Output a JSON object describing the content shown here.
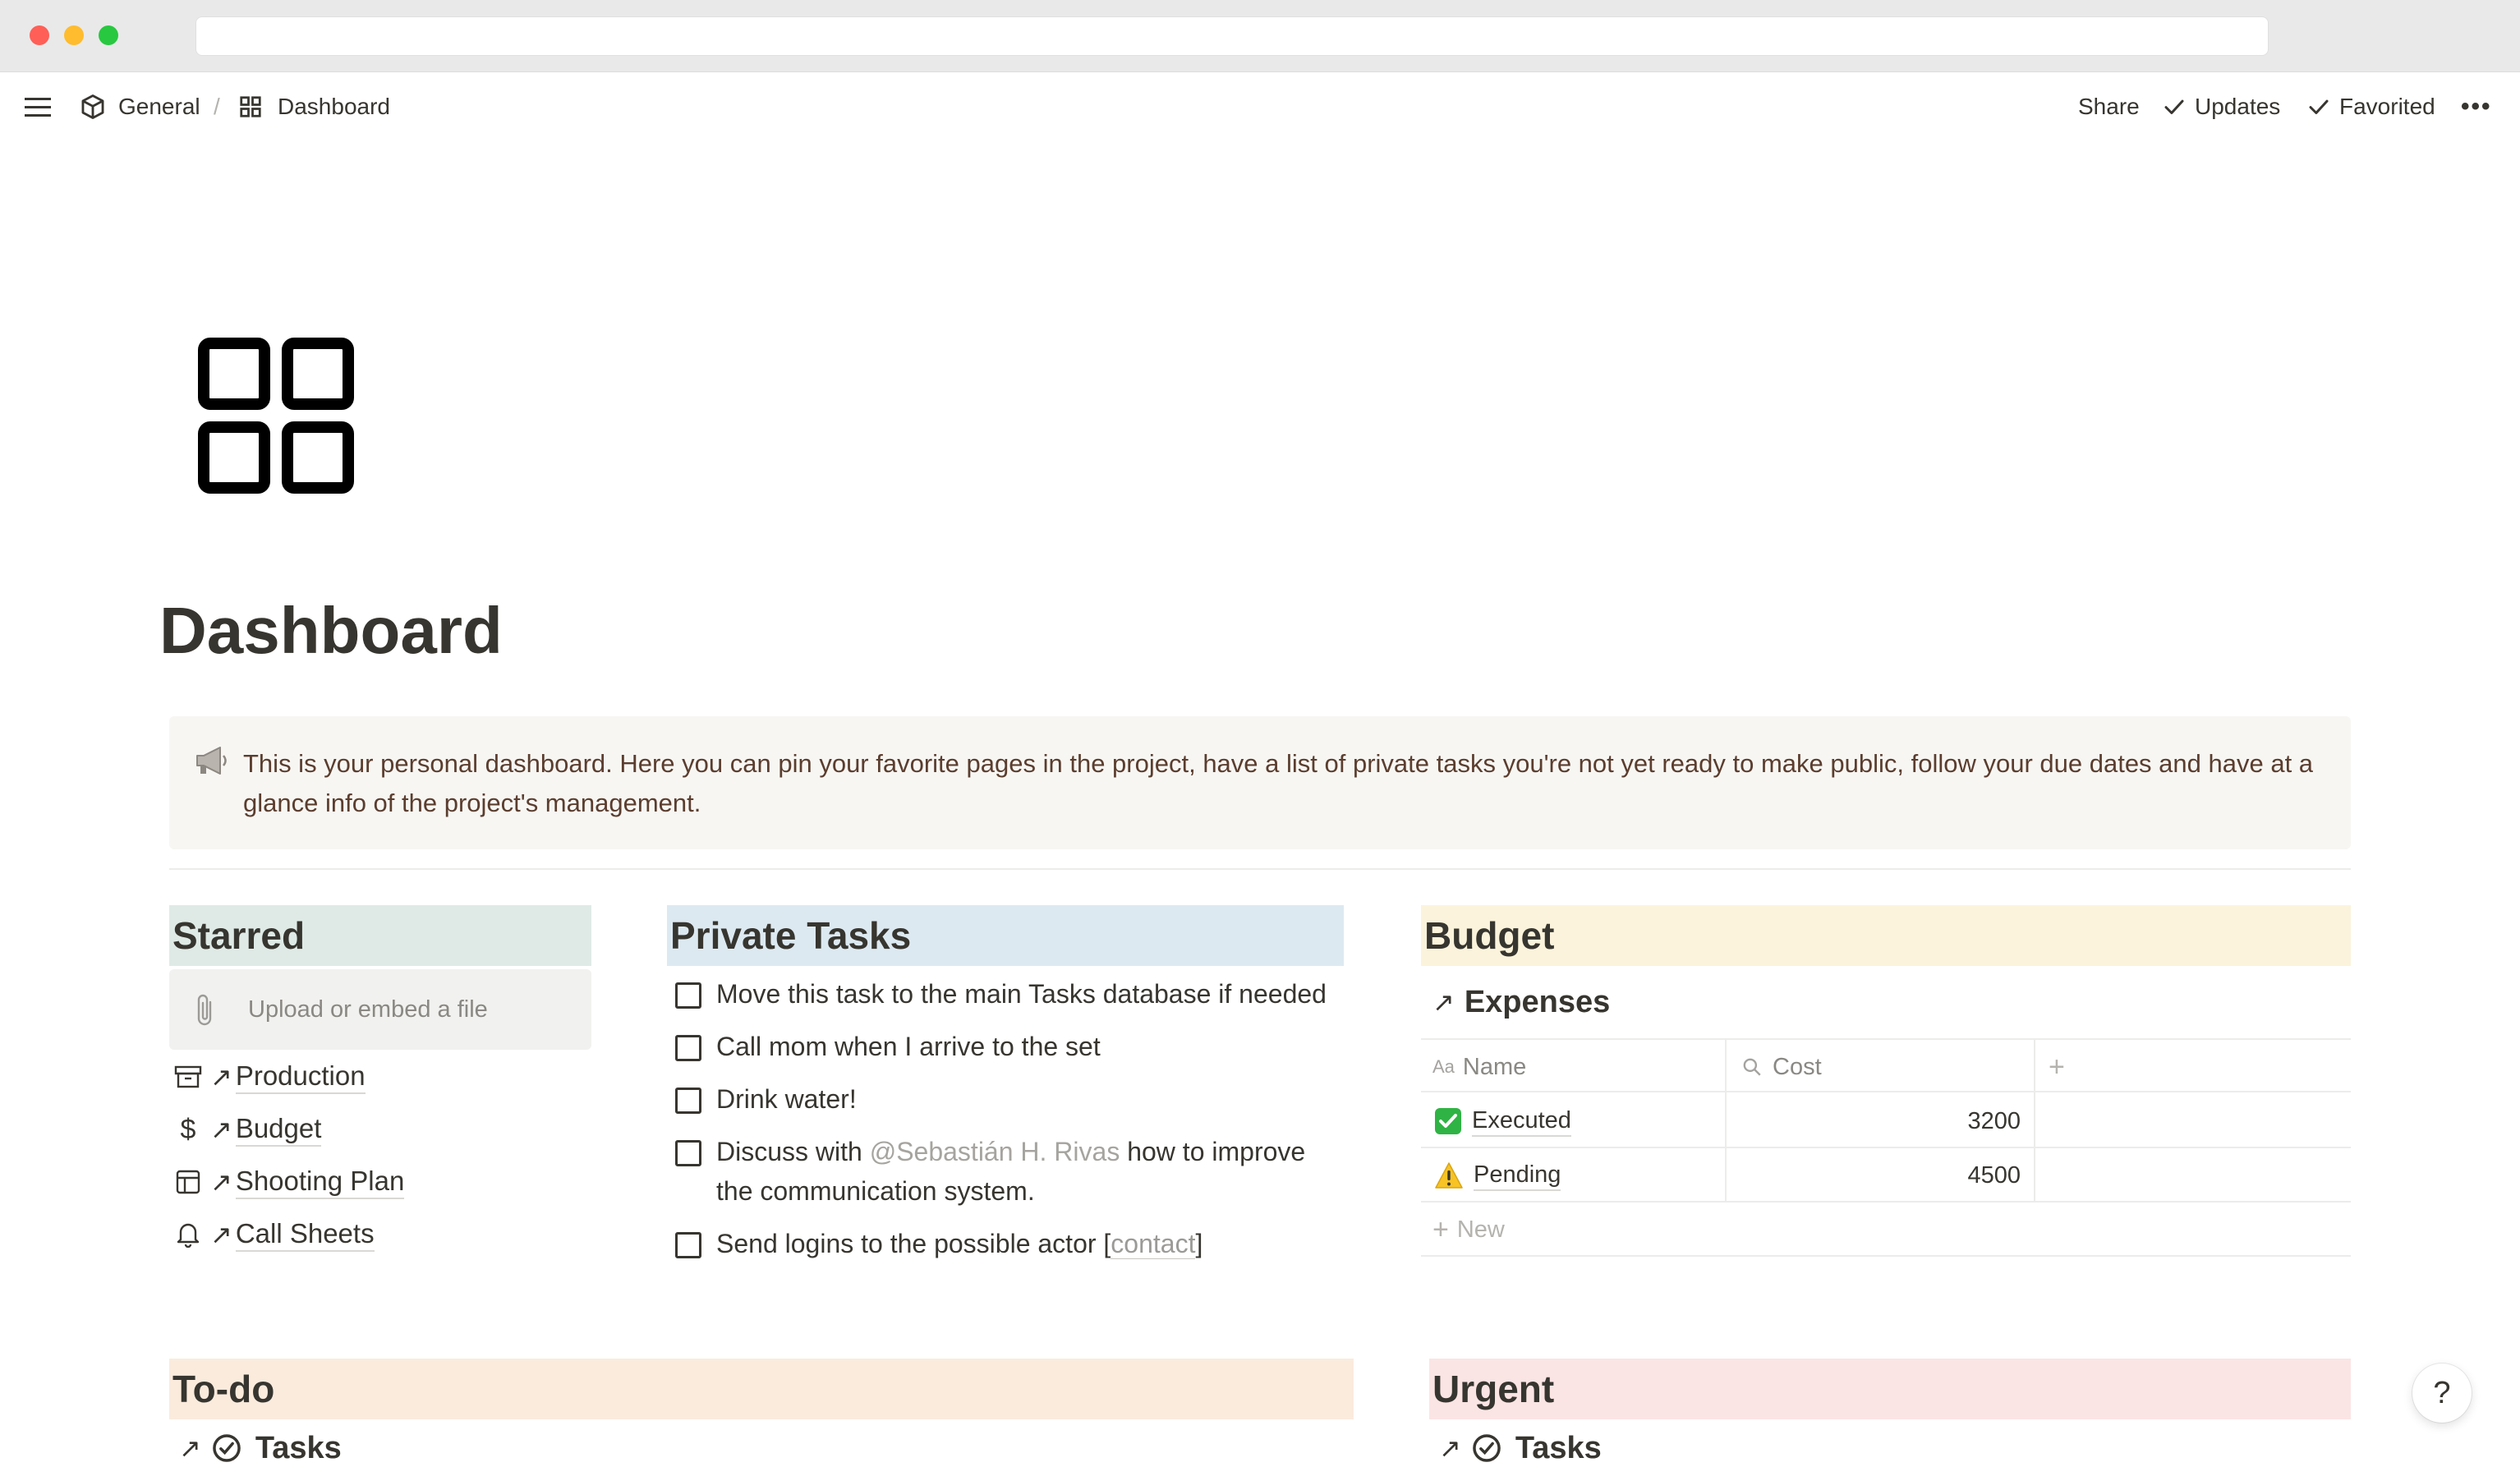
{
  "breadcrumb": {
    "workspace": "General",
    "separator": "/",
    "page": "Dashboard"
  },
  "topbar_actions": {
    "share": "Share",
    "updates": "Updates",
    "favorited": "Favorited",
    "more": "•••"
  },
  "page": {
    "title": "Dashboard"
  },
  "callout": {
    "icon": "megaphone-icon",
    "text": "This is your personal dashboard. Here you can pin your favorite pages in the project, have a list of private tasks you're not yet ready to make public, follow your due dates and have at a glance info of the project's management."
  },
  "starred": {
    "title": "Starred",
    "upload_label": "Upload or embed a file",
    "links": [
      {
        "label": "Production",
        "icon": "archive-box-icon"
      },
      {
        "label": "Budget",
        "icon": "dollar-icon"
      },
      {
        "label": "Shooting Plan",
        "icon": "layout-icon"
      },
      {
        "label": "Call Sheets",
        "icon": "bell-icon"
      }
    ]
  },
  "private_tasks": {
    "title": "Private Tasks",
    "items": [
      {
        "text": "Move this task to the main Tasks database if needed"
      },
      {
        "text": "Call mom when I arrive to the set"
      },
      {
        "text": "Drink water!"
      },
      {
        "pre": "Discuss with ",
        "mention": "@Sebastián H. Rivas",
        "post": " how to improve the communication system."
      },
      {
        "pre": "Send logins to the possible actor [",
        "link": "contact",
        "post": "]"
      }
    ]
  },
  "budget": {
    "title": "Budget",
    "linked_db": "Expenses",
    "columns": {
      "name": "Name",
      "cost": "Cost",
      "add": "+"
    },
    "rows": [
      {
        "name": "Executed",
        "cost": "3200",
        "icon": "check-mark-button-icon"
      },
      {
        "name": "Pending",
        "cost": "4500",
        "icon": "warning-icon"
      }
    ],
    "new_label": "New"
  },
  "todo": {
    "title": "To-do",
    "linked_db": "Tasks"
  },
  "urgent": {
    "title": "Urgent",
    "linked_db": "Tasks"
  },
  "help": {
    "label": "?"
  },
  "colors": {
    "starred_bg": "#dfeae6",
    "private_tasks_bg": "#dde9f1",
    "budget_bg": "#fbf3db",
    "todo_bg": "#faebdd",
    "urgent_bg": "#fbe4e4",
    "callout_bg": "#f7f6f3"
  }
}
